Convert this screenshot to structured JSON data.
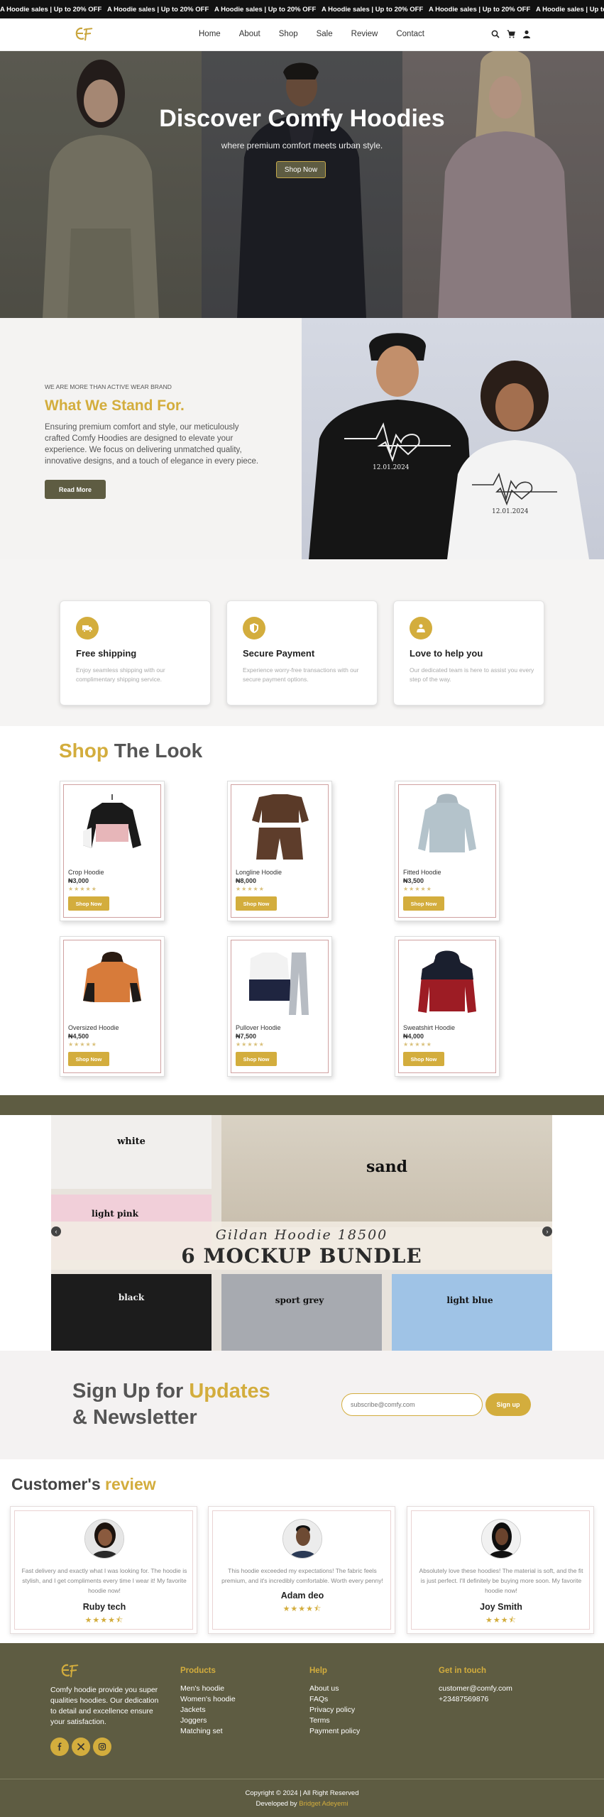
{
  "announcement": {
    "items": [
      "A Hoodie sales | Up to 20% OFF",
      "A Hoodie sales | Up to 20% OFF",
      "A Hoodie sales | Up to 20% OFF",
      "A Hoodie sales | Up to 20% OFF",
      "A Hoodie sales | Up to 20% OFF",
      "A Hoodie sales | Up to 20% OFF"
    ]
  },
  "nav": {
    "links": [
      "Home",
      "About",
      "Shop",
      "Sale",
      "Review",
      "Contact"
    ],
    "icons": [
      "search-icon",
      "cart-icon",
      "user-icon"
    ]
  },
  "hero": {
    "title": "Discover Comfy Hoodies",
    "subtitle": "where premium comfort meets urban style.",
    "button": "Shop Now"
  },
  "about": {
    "kicker": "WE ARE MORE THAN ACTIVE WEAR BRAND",
    "title": "What We Stand For.",
    "text": "Ensuring premium comfort and style, our meticulously crafted Comfy Hoodies are designed to elevate your experience. We focus on delivering unmatched quality, innovative designs, and a touch of elegance in every piece.",
    "button": "Read More",
    "shirt_date": "12.01.2024"
  },
  "features": [
    {
      "icon": "truck-icon",
      "title": "Free shipping",
      "text": "Enjoy seamless shipping with our complimentary shipping service."
    },
    {
      "icon": "shield-icon",
      "title": "Secure Payment",
      "text": "Experience worry-free transactions with our secure payment options."
    },
    {
      "icon": "support-icon",
      "title": "Love to help you",
      "text": "Our dedicated team is here to assist you every step of the way."
    }
  ],
  "shop": {
    "title_a": "Shop",
    "title_b": "The Look",
    "stars": "★★★★★",
    "button": "Shop Now",
    "products": [
      {
        "name": "Crop Hoodie",
        "price": "₦3,000"
      },
      {
        "name": "Longline Hoodie",
        "price": "₦8,000"
      },
      {
        "name": "Fitted Hoodie",
        "price": "₦3,500"
      },
      {
        "name": "Oversized Hoodie",
        "price": "₦4,500"
      },
      {
        "name": "Pullover Hoodie",
        "price": "₦7,500"
      },
      {
        "name": "Sweatshirt Hoodie",
        "price": "₦4,000"
      }
    ]
  },
  "banner": {
    "labels": [
      "white",
      "sand",
      "light pink",
      "black",
      "sport grey",
      "light blue"
    ],
    "script": "Gildan Hoodie 18500",
    "headline": "6 MOCKUP BUNDLE",
    "prev": "‹",
    "next": "›"
  },
  "newsletter": {
    "title_a": "Sign Up for",
    "title_b": "Updates",
    "title_c": "& Newsletter",
    "placeholder": "subscribe@comfy.com",
    "button": "Sign up"
  },
  "reviews": {
    "title_a": "Customer's",
    "title_b": "review",
    "items": [
      {
        "text": "Fast delivery and exactly what I was looking for. The hoodie is stylish, and I get compliments every time I wear it! My favorite hoodie now!",
        "name": "Ruby tech",
        "stars": "★★★★⯪"
      },
      {
        "text": "This hoodie exceeded my expectations! The fabric feels premium, and it's incredibly comfortable. Worth every penny!",
        "name": "Adam deo",
        "stars": "★★★★⯪"
      },
      {
        "text": "Absolutely love these hoodies! The material is soft, and the fit is just perfect. I'll definitely be buying more soon. My favorite hoodie now!",
        "name": "Joy Smith",
        "stars": "★★★⯪"
      }
    ]
  },
  "footer": {
    "about": "Comfy hoodie provide you super qualities hoodies. Our dedication to detail and excellence ensure your satisfaction.",
    "social": [
      "facebook-icon",
      "x-icon",
      "instagram-icon"
    ],
    "columns": [
      {
        "title": "Products",
        "items": [
          "Men's hoodie",
          "Women's hoodie",
          "Jackets",
          "Joggers",
          "Matching set"
        ]
      },
      {
        "title": "Help",
        "items": [
          "About us",
          "FAQs",
          "Privacy policy",
          "Terms",
          "Payment policy"
        ]
      },
      {
        "title": "Get in touch",
        "items": [
          "customer@comfy.com",
          "+23487569876"
        ]
      }
    ],
    "copyright": "Copyright © 2024 | All Right Reserved",
    "dev_prefix": "Developed by",
    "dev_name": "Bridget Adeyemi"
  },
  "colors": {
    "accent": "#d3ad3d",
    "olive": "#5e5c42",
    "dark": "#111111"
  }
}
